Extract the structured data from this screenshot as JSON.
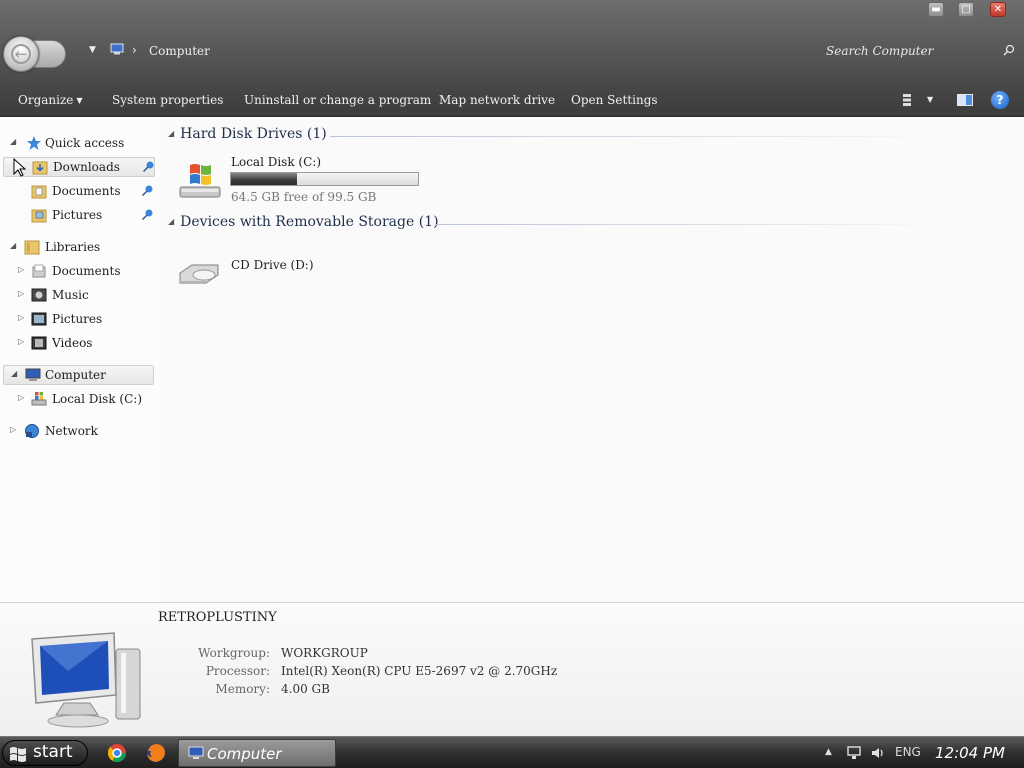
{
  "window": {
    "controls": {
      "minimize": "▬",
      "maximize": "□",
      "close": "✕"
    },
    "address": {
      "breadcrumb": "Computer",
      "separator": "›",
      "recent_caret": "▼"
    },
    "search": {
      "placeholder": "Search Computer"
    }
  },
  "toolbar": {
    "organize": "Organize",
    "system_properties": "System properties",
    "uninstall": "Uninstall or change a program",
    "map_drive": "Map network drive",
    "open_settings": "Open Settings",
    "help": "?"
  },
  "nav": {
    "quick_access": "Quick access",
    "quick_items": [
      "Downloads",
      "Documents",
      "Pictures"
    ],
    "libraries": "Libraries",
    "library_items": [
      "Documents",
      "Music",
      "Pictures",
      "Videos"
    ],
    "computer": "Computer",
    "computer_items": [
      "Local Disk (C:)"
    ],
    "network": "Network",
    "expanded_glyph": "◢",
    "collapsed_glyph": "▷"
  },
  "content": {
    "hard_disks": {
      "title": "Hard Disk Drives (1)",
      "drives": [
        {
          "name": "Local Disk (C:)",
          "free_text": "64.5 GB free of 99.5 GB",
          "used_fraction": 0.352
        }
      ]
    },
    "removable": {
      "title": "Devices with Removable Storage (1)",
      "drives": [
        {
          "name": "CD Drive (D:)"
        }
      ]
    }
  },
  "details": {
    "computer_name": "RETROPLUSTINY",
    "workgroup_label": "Workgroup:",
    "workgroup": "WORKGROUP",
    "processor_label": "Processor:",
    "processor": "Intel(R) Xeon(R) CPU E5-2697 v2 @ 2.70GHz",
    "memory_label": "Memory:",
    "memory": "4.00 GB"
  },
  "taskbar": {
    "start_label": "start",
    "active_window": "Computer",
    "tray_language": "ENG",
    "tray_caret": "▲",
    "clock": "12:04 PM"
  }
}
